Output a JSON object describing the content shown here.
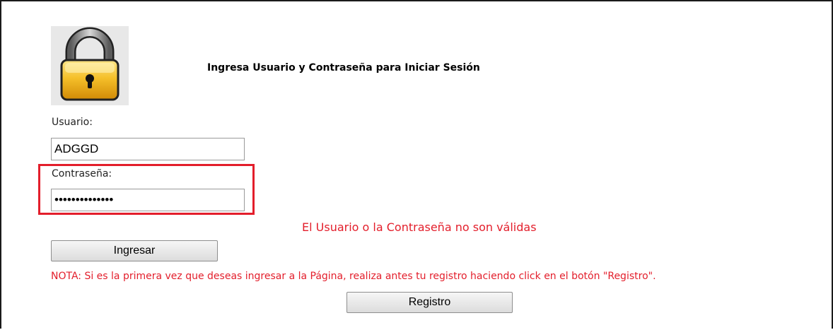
{
  "header": {
    "title": "Ingresa Usuario y Contraseña para Iniciar Sesión",
    "icon": "padlock-icon"
  },
  "form": {
    "username_label": "Usuario:",
    "username_value": "ADGGD",
    "password_label": "Contraseña:",
    "password_value": "••••••••••••••",
    "error_message": "El Usuario o la Contraseña no son válidas",
    "login_button": "Ingresar",
    "note": "NOTA: Si es la primera vez que deseas ingresar a la Página, realiza antes tu registro haciendo click en el botón \"Registro\".",
    "register_button": "Registro"
  },
  "colors": {
    "error": "#e31e2b",
    "highlight": "#e31e2b",
    "lock_body": "#f2b91c",
    "lock_shackle": "#9a9a9a"
  }
}
